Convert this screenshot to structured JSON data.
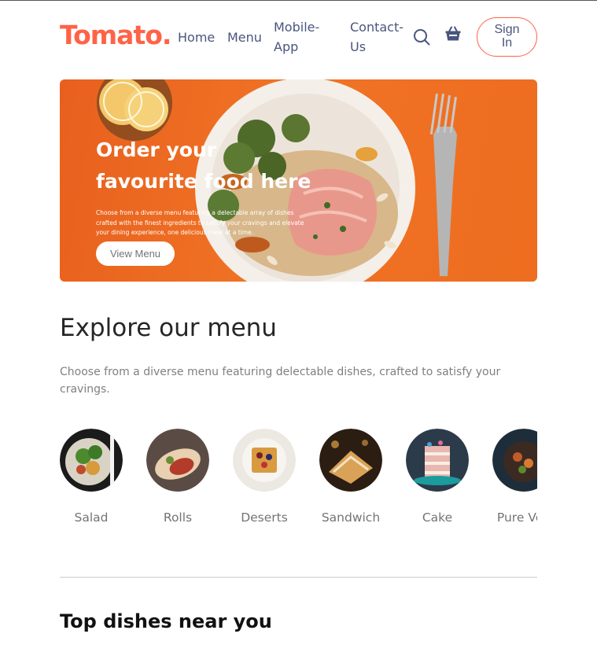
{
  "navbar": {
    "logo": "Tomato.",
    "links": [
      "Home",
      "Menu",
      "Mobile-App",
      "Contact-Us"
    ],
    "mobile_line1": "Mobile-",
    "mobile_line2": "App",
    "contact_line1": "Contact-",
    "contact_line2": "Us",
    "search_icon": "search-icon",
    "basket_icon": "basket-icon",
    "signin_line1": "Sign",
    "signin_line2": "In",
    "accent_color": "#ff6347"
  },
  "hero": {
    "title_line1": "Order your",
    "title_line2": "favourite food here",
    "description": "Choose from a diverse menu featuring a delectable array of dishes crafted with the finest ingredients to satisfy your cravings and elevate your dining experience, one delicious meal at a time.",
    "button_label": "View Menu"
  },
  "explore": {
    "title": "Explore our menu",
    "description": "Choose from a diverse menu featuring delectable dishes, crafted to satisfy your cravings.",
    "items": [
      {
        "label": "Salad"
      },
      {
        "label": "Rolls"
      },
      {
        "label": "Deserts"
      },
      {
        "label": "Sandwich"
      },
      {
        "label": "Cake"
      },
      {
        "label": "Pure Veg"
      }
    ]
  },
  "top_dishes": {
    "title": "Top dishes near you"
  }
}
